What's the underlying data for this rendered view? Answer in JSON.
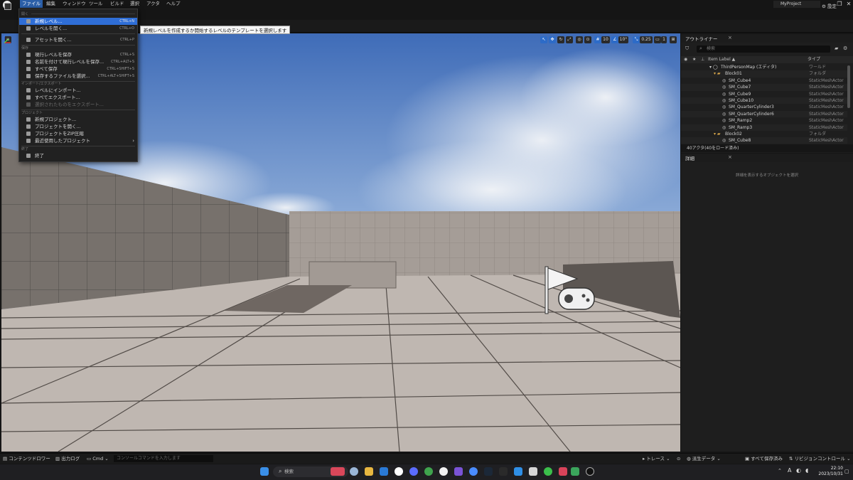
{
  "window": {
    "project_name": "MyProject",
    "logo_text": "U"
  },
  "menubar": [
    "ファイル",
    "編集",
    "ウィンドウ",
    "ツール",
    "ビルド",
    "選択",
    "アクタ",
    "ヘルプ"
  ],
  "toolbar": {
    "settings_label": "設定"
  },
  "viewport": {
    "snap_value": "10",
    "rotation_snap": "10°",
    "scale_snap": "0.25",
    "camera_speed": "1"
  },
  "file_menu": {
    "sections": {
      "open": "開く",
      "save": "保存",
      "import_export": "インポート/エクスポート",
      "project": "プロジェクト",
      "exit": "終了"
    },
    "items": [
      {
        "label": "新規レベル...",
        "shortcut": "CTRL+N"
      },
      {
        "label": "レベルを開く...",
        "shortcut": "CTRL+O"
      },
      {
        "label": "アセットを開く...",
        "shortcut": "CTRL+P"
      },
      {
        "label": "現行レベルを保存",
        "shortcut": "CTRL+S"
      },
      {
        "label": "名前を付けて現行レベルを保存...",
        "shortcut": "CTRL+ALT+S"
      },
      {
        "label": "すべて保存",
        "shortcut": "CTRL+SHIFT+S"
      },
      {
        "label": "保存するファイルを選択...",
        "shortcut": "CTRL+ALT+SHIFT+S"
      },
      {
        "label": "レベルにインポート...",
        "shortcut": ""
      },
      {
        "label": "すべてエクスポート...",
        "shortcut": ""
      },
      {
        "label": "選択されたものをエクスポート...",
        "shortcut": ""
      },
      {
        "label": "新規プロジェクト...",
        "shortcut": ""
      },
      {
        "label": "プロジェクトを開く...",
        "shortcut": ""
      },
      {
        "label": "プロジェクトをZIP圧縮",
        "shortcut": ""
      },
      {
        "label": "最近使用したプロジェクト",
        "shortcut": ""
      },
      {
        "label": "終了",
        "shortcut": ""
      }
    ],
    "tooltip": "新規レベルを作成するか開始するレベルのテンプレートを選択します"
  },
  "outliner": {
    "tab_label": "アウトライナー",
    "search_placeholder": "検索",
    "col_label": "Item Label ▲",
    "col_type": "タイプ",
    "rows": [
      {
        "label": "ThirdPersonMap (エディタ)",
        "type": "ワールド"
      },
      {
        "label": "Block01",
        "type": "フォルダ"
      },
      {
        "label": "SM_Cube4",
        "type": "StaticMeshActor"
      },
      {
        "label": "SM_Cube7",
        "type": "StaticMeshActor"
      },
      {
        "label": "SM_Cube9",
        "type": "StaticMeshActor"
      },
      {
        "label": "SM_Cube10",
        "type": "StaticMeshActor"
      },
      {
        "label": "SM_QuarterCylinder3",
        "type": "StaticMeshActor"
      },
      {
        "label": "SM_QuarterCylinder6",
        "type": "StaticMeshActor"
      },
      {
        "label": "SM_Ramp2",
        "type": "StaticMeshActor"
      },
      {
        "label": "SM_Ramp3",
        "type": "StaticMeshActor"
      },
      {
        "label": "Block02",
        "type": "フォルダ"
      },
      {
        "label": "SM_Cube8",
        "type": "StaticMeshActor"
      }
    ],
    "footer": "40アクタ(40をロード済み)"
  },
  "details": {
    "tab_label": "詳細",
    "empty_text": "詳細を表示するオブジェクトを選択"
  },
  "statusbar": {
    "content_drawer": "コンテンツドロワー",
    "output_log": "出力ログ",
    "cmd": "Cmd",
    "console_placeholder": "コンソールコマンドを入力します",
    "trace": "トレース",
    "derived_data": "派生データ",
    "all_saved": "すべて保存済み",
    "revision_control": "リビジョンコントロール"
  },
  "taskbar": {
    "search_placeholder": "検索",
    "time": "22:10",
    "date": "2023/10/31",
    "ime": "A"
  }
}
